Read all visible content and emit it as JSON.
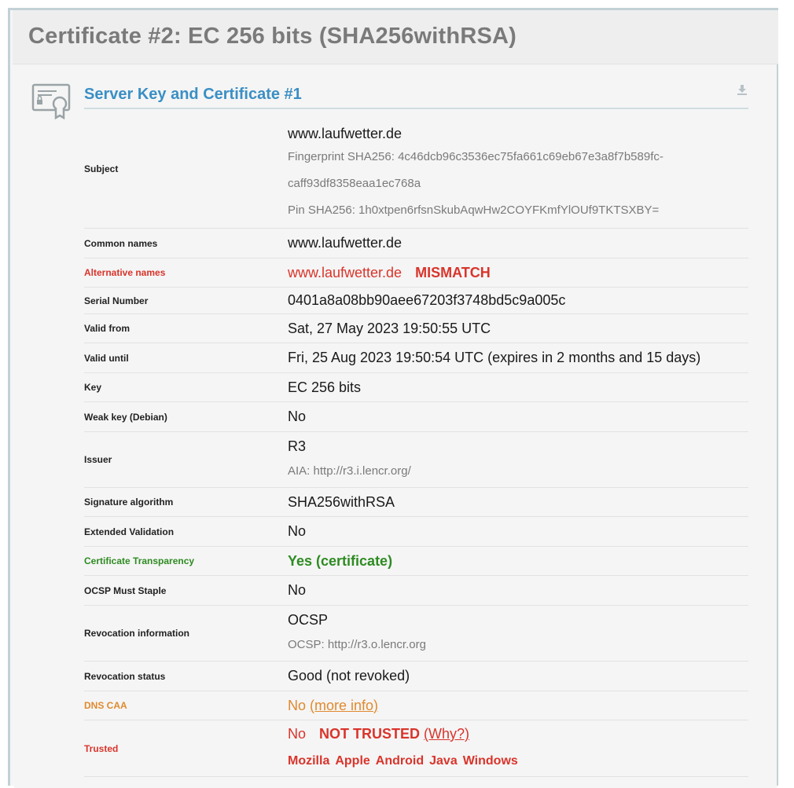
{
  "header": {
    "title": "Certificate #2: EC 256 bits (SHA256withRSA)"
  },
  "section": {
    "title": "Server Key and Certificate #1",
    "icon": "certificate-icon",
    "download_icon": "download-icon"
  },
  "rows": {
    "subject": {
      "label": "Subject",
      "value": "www.laufwetter.de",
      "fingerprint_line1": "Fingerprint SHA256: 4c46dcb96c3536ec75fa661c69eb67e3a8f7b589fc-",
      "fingerprint_line2": "caff93df8358eaa1ec768a",
      "pin": "Pin SHA256: 1h0xtpen6rfsnSkubAqwHw2COYFKmfYlOUf9TKTSXBY="
    },
    "common_names": {
      "label": "Common names",
      "value": "www.laufwetter.de"
    },
    "alt_names": {
      "label": "Alternative names",
      "value": "www.laufwetter.de",
      "flag": "MISMATCH"
    },
    "serial": {
      "label": "Serial Number",
      "value": "0401a8a08bb90aee67203f3748bd5c9a005c"
    },
    "valid_from": {
      "label": "Valid from",
      "value": "Sat, 27 May 2023 19:50:55 UTC"
    },
    "valid_until": {
      "label": "Valid until",
      "value": "Fri, 25 Aug 2023 19:50:54 UTC (expires in 2 months and 15 days)"
    },
    "key": {
      "label": "Key",
      "value": "EC 256 bits"
    },
    "weak_key": {
      "label": "Weak key (Debian)",
      "value": "No"
    },
    "issuer": {
      "label": "Issuer",
      "value": "R3",
      "aia": "AIA: http://r3.i.lencr.org/"
    },
    "sig_alg": {
      "label": "Signature algorithm",
      "value": "SHA256withRSA"
    },
    "ev": {
      "label": "Extended Validation",
      "value": "No"
    },
    "ct": {
      "label": "Certificate Transparency",
      "value": "Yes (certificate)"
    },
    "ocsp_staple": {
      "label": "OCSP Must Staple",
      "value": "No"
    },
    "revocation_info": {
      "label": "Revocation information",
      "value": "OCSP",
      "ocsp_url": "OCSP: http://r3.o.lencr.org"
    },
    "revocation_status": {
      "label": "Revocation status",
      "value": "Good (not revoked)"
    },
    "dns_caa": {
      "label": "DNS CAA",
      "value": "No",
      "link": "(more info)"
    },
    "trusted": {
      "label": "Trusted",
      "value": "No",
      "flag": "NOT TRUSTED",
      "link": "(Why?)",
      "stores": [
        "Mozilla",
        "Apple",
        "Android",
        "Java",
        "Windows"
      ]
    }
  },
  "colors": {
    "accent": "#3a8fc4",
    "error": "#d9342b",
    "success": "#2e8b22",
    "warning": "#e08a2e"
  }
}
